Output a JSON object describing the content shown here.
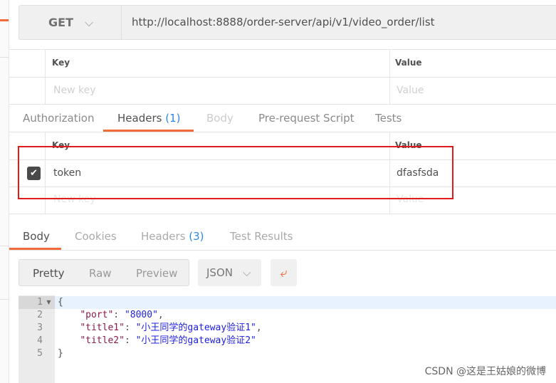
{
  "request": {
    "method": "GET",
    "url": "http://localhost:8888/order-server/api/v1/video_order/list"
  },
  "params_table": {
    "key_header": "Key",
    "value_header": "Value",
    "key_placeholder": "New key",
    "value_placeholder": "Value"
  },
  "request_tabs": [
    {
      "label": "Authorization"
    },
    {
      "label": "Headers",
      "count": "(1)"
    },
    {
      "label": "Body"
    },
    {
      "label": "Pre-request Script"
    },
    {
      "label": "Tests"
    }
  ],
  "headers_table": {
    "key_header": "Key",
    "value_header": "Value",
    "rows": [
      {
        "key": "token",
        "value": "dfasfsda",
        "checked": true
      }
    ],
    "key_placeholder": "New key",
    "value_placeholder": "Value"
  },
  "response_tabs": [
    {
      "label": "Body"
    },
    {
      "label": "Cookies"
    },
    {
      "label": "Headers",
      "count": "(3)"
    },
    {
      "label": "Test Results"
    }
  ],
  "view_modes": [
    "Pretty",
    "Raw",
    "Preview"
  ],
  "format": "JSON",
  "code_lines": [
    {
      "n": "1",
      "parts": [
        [
          "p",
          "{"
        ]
      ]
    },
    {
      "n": "2",
      "parts": [
        [
          "p",
          "    "
        ],
        [
          "k",
          "\"port\""
        ],
        [
          "p",
          ": "
        ],
        [
          "s",
          "\"8000\""
        ],
        [
          "p",
          ","
        ]
      ]
    },
    {
      "n": "3",
      "parts": [
        [
          "p",
          "    "
        ],
        [
          "k",
          "\"title1\""
        ],
        [
          "p",
          ": "
        ],
        [
          "s",
          "\"小王同学的gateway验证1\""
        ],
        [
          "p",
          ","
        ]
      ]
    },
    {
      "n": "4",
      "parts": [
        [
          "p",
          "    "
        ],
        [
          "k",
          "\"title2\""
        ],
        [
          "p",
          ": "
        ],
        [
          "s",
          "\"小王同学的gateway验证2\""
        ]
      ]
    },
    {
      "n": "5",
      "parts": [
        [
          "p",
          "}"
        ]
      ]
    }
  ],
  "watermark": "CSDN @这是王姑娘的微博"
}
